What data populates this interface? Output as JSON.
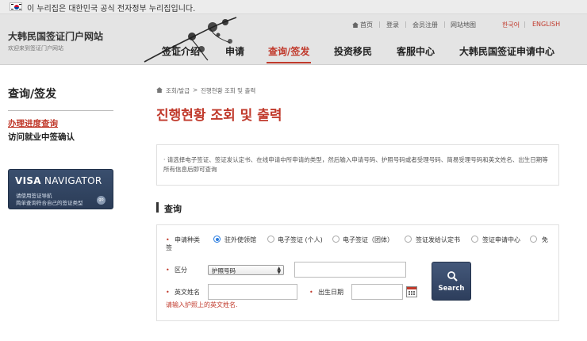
{
  "gov_banner": {
    "text": "이 누리집은 대한민국 공식 전자정부 누리집입니다."
  },
  "header": {
    "brand_title": "大韩民国签证门户网站",
    "brand_subtitle": "欢迎来到签证门户网站",
    "utility": {
      "home": "首页",
      "login": "登录",
      "join": "会员注册",
      "sitemap": "网站地图",
      "lang_ko": "한국어",
      "lang_en": "ENGLISH"
    },
    "nav": [
      {
        "label": "签证介绍",
        "active": false
      },
      {
        "label": "申请",
        "active": false
      },
      {
        "label": "查询/签发",
        "active": true
      },
      {
        "label": "投资移民",
        "active": false
      },
      {
        "label": "客服中心",
        "active": false
      },
      {
        "label": "大韩民国签证申请中心",
        "active": false
      }
    ]
  },
  "sidebar": {
    "title": "查询/签发",
    "items": [
      {
        "label": "办理进度查询",
        "active": true
      },
      {
        "label": "访问就业中签确认",
        "active": false
      }
    ],
    "visa_navigator": {
      "title_bold": "VISA",
      "title_rest": " NAVIGATOR",
      "line1": "请使用签证导航",
      "line2": "简单查询符合自己的签证类型",
      "go": "go"
    }
  },
  "content": {
    "breadcrumb": [
      "조회/발급",
      ">",
      "진행현황 조회 및 출력"
    ],
    "title": "진행현황 조회 및 출력",
    "info": "· 请选择电子签证、签证发认定书、在线申请中所申请的类型，然后输入申请号码、护照号码或者受理号码、简易受理号码和英文姓名、出生日期等所有信息后即可查询",
    "section_title": "查询",
    "form": {
      "apply_type_label": "申请种类",
      "apply_type_tail": "签",
      "options": [
        {
          "label": "驻外使领馆",
          "checked": true
        },
        {
          "label": "电子签证 (个人)",
          "checked": false
        },
        {
          "label": "电子签证（团体）",
          "checked": false
        },
        {
          "label": "签证发给认定书",
          "checked": false
        },
        {
          "label": "签证申请中心",
          "checked": false
        },
        {
          "label": "免",
          "checked": false
        }
      ],
      "division_label": "区分",
      "division_selected": "护照号码",
      "passport_value": "",
      "name_label": "英文姓名",
      "name_value": "",
      "dob_label": "出生日期",
      "dob_value": "",
      "error": "请输入护照上的英文姓名.",
      "search_label": "Search"
    }
  },
  "colors": {
    "accent": "#c0392b",
    "navy": "#2d3e5c",
    "radio": "#2b7de0"
  },
  "icons": [
    "korea-flag-icon",
    "home-icon",
    "ink-branch-decoration",
    "calendar-icon",
    "magnifier-icon",
    "go-icon"
  ]
}
